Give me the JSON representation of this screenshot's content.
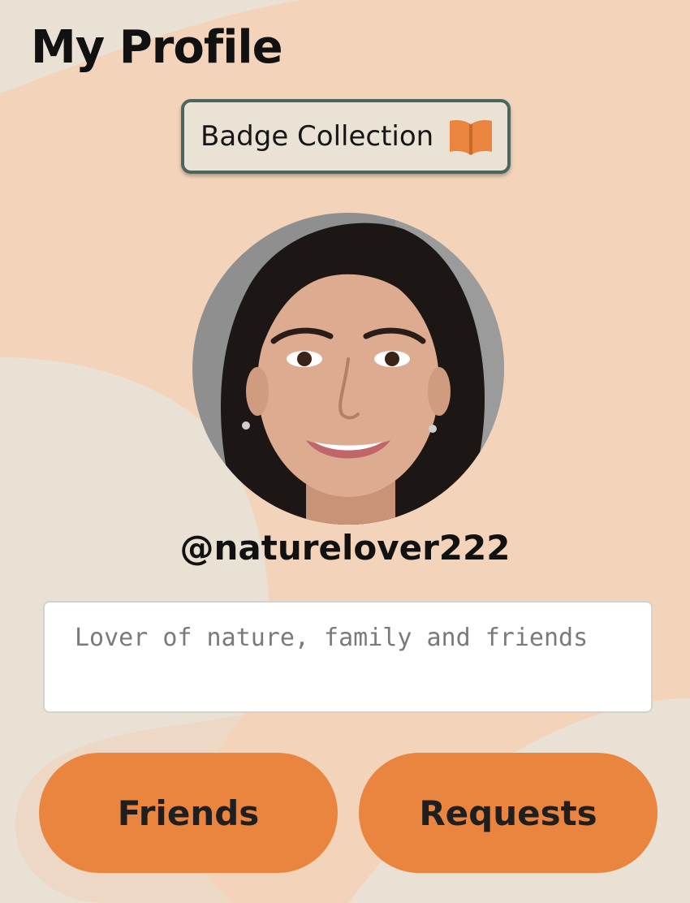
{
  "header": {
    "title": "My Profile"
  },
  "badge_button": {
    "label": "Badge Collection",
    "icon": "open-book-icon"
  },
  "profile": {
    "username": "@naturelover222",
    "bio_placeholder": "Lover of nature, family and friends",
    "bio_value": ""
  },
  "actions": {
    "friends_label": "Friends",
    "requests_label": "Requests"
  },
  "colors": {
    "background": "#e9e1d4",
    "blob": "#f3d4ba",
    "accent": "#e9853f",
    "badge_border": "#4b6660"
  }
}
